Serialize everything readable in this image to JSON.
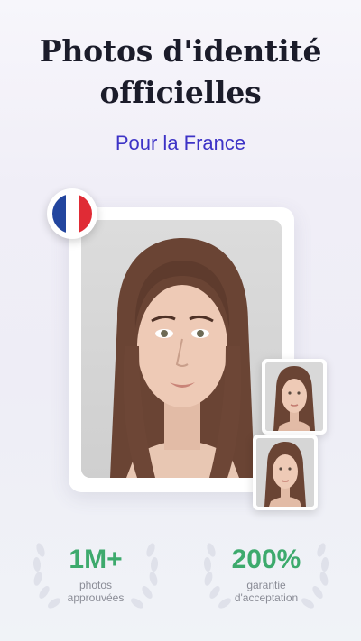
{
  "header": {
    "title_line1": "Photos d'identité",
    "title_line2": "officielles",
    "subtitle": "Pour la France"
  },
  "flag": {
    "icon": "france-flag-icon",
    "colors": [
      "#22459e",
      "#ffffff",
      "#e02b35"
    ]
  },
  "stats": [
    {
      "value": "1M+",
      "label_line1": "photos",
      "label_line2": "approuvées"
    },
    {
      "value": "200%",
      "label_line1": "garantie",
      "label_line2": "d'acceptation"
    }
  ],
  "colors": {
    "title": "#1b1c2a",
    "subtitle": "#3d33c6",
    "stat_value": "#3daa6d",
    "stat_label": "#8a8c96"
  }
}
